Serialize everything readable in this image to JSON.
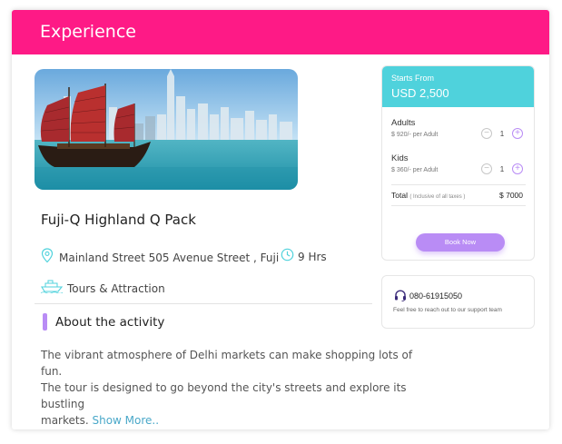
{
  "header": {
    "title": "Experience"
  },
  "package": {
    "title": "Fuji-Q Highland Q Pack",
    "location": "Mainland Street 505 Avenue Street , Fuji",
    "duration": "9 Hrs",
    "category": "Tours & Attraction",
    "photo_icon": "harbor-junk-boat-photo"
  },
  "about": {
    "heading": "About the activity",
    "description_lines": [
      "The vibrant atmosphere of Delhi markets can make shopping lots of fun.",
      "The tour is designed to go beyond the city's streets and explore its bustling",
      "markets."
    ],
    "show_more": "Show More.."
  },
  "pricing": {
    "starts_from": "Starts From",
    "amount": "USD 2,500",
    "adults": {
      "label": "Adults",
      "sub": "$ 920/- per Adult",
      "qty": "1"
    },
    "kids": {
      "label": "Kids",
      "sub": "$ 360/- per Adult",
      "qty": "1"
    },
    "total_label": "Total",
    "total_note": "( Inclusive of all taxes )",
    "total_amount": "$  7000",
    "book_label": "Book Now"
  },
  "support": {
    "phone": "080-61915050",
    "note": "Feel free to reach out to our support team"
  },
  "colors": {
    "accent_pink": "#fe1a86",
    "accent_teal": "#4fd2dc",
    "accent_purple": "#b98cf5",
    "link": "#4aa8c9"
  }
}
